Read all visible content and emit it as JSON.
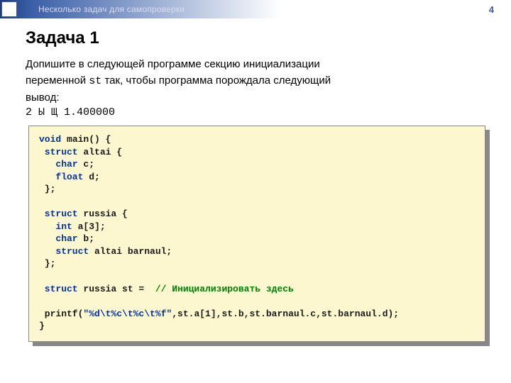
{
  "header": {
    "breadcrumb": "Несколько задач для самопроверки",
    "page_number": "4"
  },
  "heading": "Задача 1",
  "body_line1": "Допишите в следующей программе секцию инициализации",
  "body_line2a": "переменной ",
  "body_line2_mono": "st",
  "body_line2b": " так, чтобы программа порождала следующий",
  "body_line3": "вывод:",
  "output": "2 Ы Щ 1.400000",
  "code": {
    "l01a": "void",
    "l01b": " main() {",
    "l02a": " struct",
    "l02b": " altai {",
    "l03a": "   char",
    "l03b": " c;",
    "l04a": "   float",
    "l04b": " d;",
    "l05": " };",
    "blank1": "",
    "l06a": " struct",
    "l06b": " russia {",
    "l07a": "   int",
    "l07b": " a[3];",
    "l08a": "   char",
    "l08b": " b;",
    "l09a": "   struct",
    "l09b": " altai barnaul;",
    "l10": " };",
    "blank2": "",
    "l11a": " struct",
    "l11b": " russia st =  ",
    "l11c": "// Инициализировать здесь",
    "blank3": "",
    "l12a": " printf(",
    "l12b": "\"%d\\t%c\\t%c\\t%f\"",
    "l12c": ",st.a[1],st.b,st.barnaul.c,st.barnaul.d);",
    "l13": "}"
  }
}
